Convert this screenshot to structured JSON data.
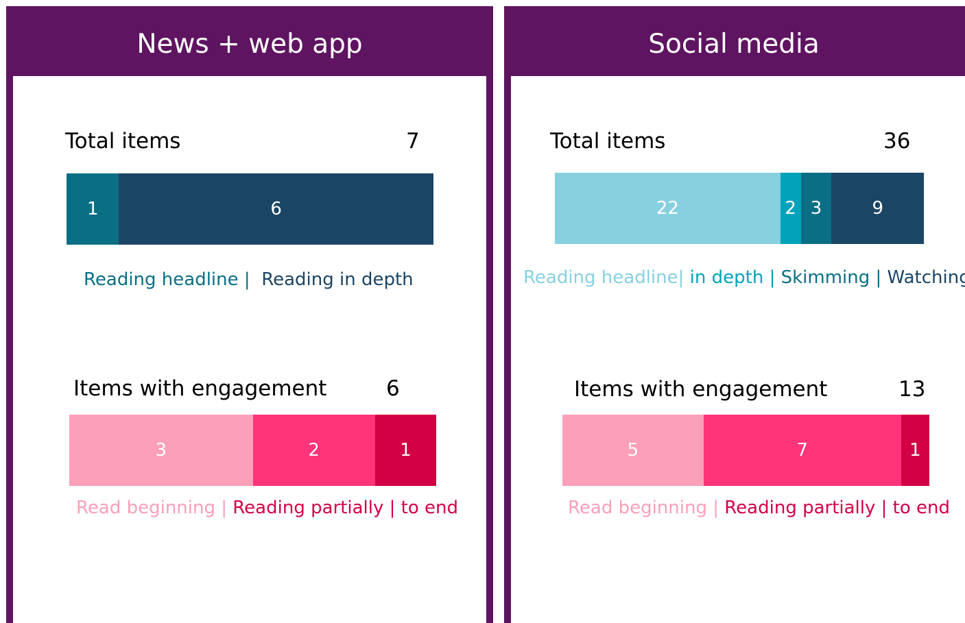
{
  "colors": {
    "purple": "#5e1460",
    "teal_light": "#87d0e0",
    "teal_mid": "#00a3ba",
    "teal": "#0a6e84",
    "navy": "#1b4565",
    "pink_light": "#fba0b8",
    "pink": "#ff3479",
    "crimson": "#d30045"
  },
  "chart_data": [
    {
      "type": "bar",
      "orientation": "horizontal-stacked",
      "panel": "News + web app",
      "title": "Total items",
      "total": "7",
      "series": [
        {
          "name": "Reading headline",
          "value": 1,
          "label": "1",
          "color": "#0a6e84"
        },
        {
          "name": "Reading in depth",
          "value": 6,
          "label": "6",
          "color": "#1b4565"
        }
      ],
      "legend": [
        {
          "text": "Reading headline | ",
          "color": "#0a6e84"
        },
        {
          "text": " Reading in depth",
          "color": "#1b4565"
        }
      ]
    },
    {
      "type": "bar",
      "orientation": "horizontal-stacked",
      "panel": "News + web app",
      "title": "Items with engagement",
      "total": "6",
      "series": [
        {
          "name": "Read beginning",
          "value": 3,
          "label": "3",
          "color": "#fba0b8"
        },
        {
          "name": "Reading partially",
          "value": 2,
          "label": "2",
          "color": "#ff3479"
        },
        {
          "name": "to end",
          "value": 1,
          "label": "1",
          "color": "#d30045"
        }
      ],
      "legend": [
        {
          "text": "Read beginning | ",
          "color": "#fba0b8"
        },
        {
          "text": "Reading partially | to end",
          "color": "#d30045"
        }
      ]
    },
    {
      "type": "bar",
      "orientation": "horizontal-stacked",
      "panel": "Social media",
      "title": "Total items",
      "total": "36",
      "series": [
        {
          "name": "Reading headline",
          "value": 22,
          "label": "22",
          "color": "#87d0e0"
        },
        {
          "name": "in depth",
          "value": 2,
          "label": "2",
          "color": "#00a3ba"
        },
        {
          "name": "Skimming",
          "value": 3,
          "label": "3",
          "color": "#0a6e84"
        },
        {
          "name": "Watching",
          "value": 9,
          "label": "9",
          "color": "#1b4565"
        }
      ],
      "legend": [
        {
          "text": "Reading headline| ",
          "color": "#87d0e0"
        },
        {
          "text": "in depth | ",
          "color": "#00a3ba"
        },
        {
          "text": "Skimming | ",
          "color": "#0a6e84"
        },
        {
          "text": "Watching",
          "color": "#1b4565"
        }
      ]
    },
    {
      "type": "bar",
      "orientation": "horizontal-stacked",
      "panel": "Social media",
      "title": "Items with engagement",
      "total": "13",
      "series": [
        {
          "name": "Read beginning",
          "value": 5,
          "label": "5",
          "color": "#fba0b8"
        },
        {
          "name": "Reading partially",
          "value": 7,
          "label": "7",
          "color": "#ff3479"
        },
        {
          "name": "to end",
          "value": 1,
          "label": "1",
          "color": "#d30045"
        }
      ],
      "legend": [
        {
          "text": "Read beginning | ",
          "color": "#fba0b8"
        },
        {
          "text": "Reading partially | to end",
          "color": "#d30045"
        }
      ]
    }
  ]
}
